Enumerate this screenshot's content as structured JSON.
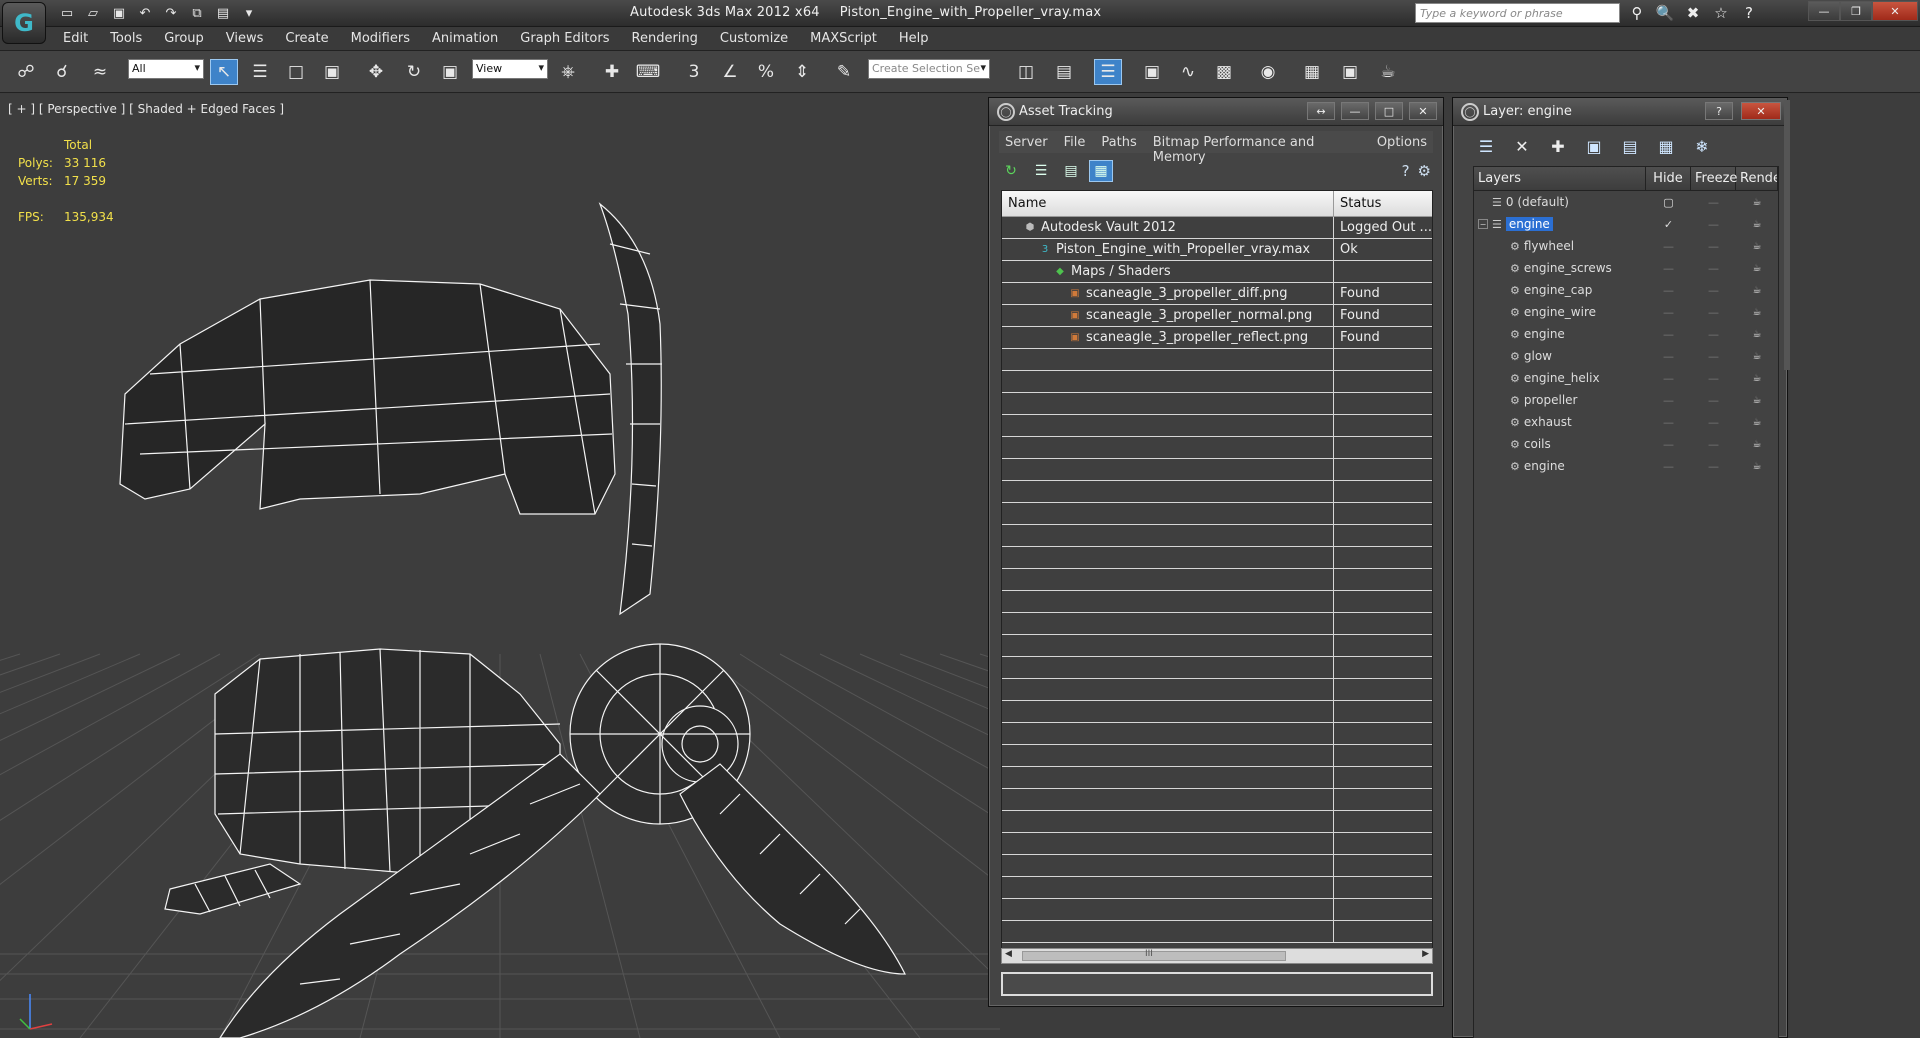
{
  "titlebar": {
    "logo_glyph": "G",
    "app_title": "Autodesk 3ds Max  2012 x64",
    "file_title": "Piston_Engine_with_Propeller_vray.max",
    "search_placeholder": "Type a keyword or phrase",
    "quick_access_icons": [
      "new-icon",
      "open-icon",
      "save-icon",
      "undo-icon",
      "redo-icon",
      "hold-icon",
      "project-icon",
      "customize-icon"
    ],
    "tool_icons": [
      "binoculars-icon",
      "key-search-icon",
      "communication-icon",
      "star-icon",
      "help-icon"
    ],
    "window_controls": [
      "minimize",
      "restore",
      "close"
    ]
  },
  "menu": [
    "Edit",
    "Tools",
    "Group",
    "Views",
    "Create",
    "Modifiers",
    "Animation",
    "Graph Editors",
    "Rendering",
    "Customize",
    "MAXScript",
    "Help"
  ],
  "toolbar": {
    "selection_filter": "All",
    "reference_coord": "View",
    "named_selection_placeholder": "Create Selection Se",
    "icons": [
      "link-icon",
      "unlink-icon",
      "bind-spacewarp-icon",
      "select-icon",
      "select-by-name-icon",
      "rect-region-icon",
      "window-crossing-icon",
      "move-icon",
      "rotate-icon",
      "scale-icon",
      "pivot-icon",
      "manipulate-icon",
      "keyboard-shortcut-icon",
      "snap-3-icon",
      "angle-snap-icon",
      "percent-snap-icon",
      "spinner-snap-icon",
      "edit-named-sel-icon",
      "mirror-icon",
      "align-icon",
      "layer-manager-icon",
      "ribbon-icon",
      "curve-editor-icon",
      "schematic-icon",
      "material-editor-icon",
      "render-setup-icon",
      "rendered-frame-icon",
      "render-icon"
    ]
  },
  "viewport": {
    "label": "[ + ] [ Perspective ] [ Shaded + Edged Faces ]",
    "stats_header": "Total",
    "polys_label": "Polys:",
    "polys_value": "33 116",
    "verts_label": "Verts:",
    "verts_value": "17 359",
    "fps_label": "FPS:",
    "fps_value": "135,934"
  },
  "asset_tracking": {
    "title": "Asset Tracking",
    "menu": [
      "Server",
      "File",
      "Paths",
      "Bitmap Performance and Memory",
      "Options"
    ],
    "col_name": "Name",
    "col_status": "Status",
    "rows": [
      {
        "name": "Autodesk Vault 2012",
        "status": "Logged Out ...",
        "indent": 1,
        "icon": "vault-icon"
      },
      {
        "name": "Piston_Engine_with_Propeller_vray.max",
        "status": "Ok",
        "indent": 2,
        "icon": "max-file-icon"
      },
      {
        "name": "Maps / Shaders",
        "status": "",
        "indent": 3,
        "icon": "maps-folder-icon"
      },
      {
        "name": "scaneagle_3_propeller_diff.png",
        "status": "Found",
        "indent": 4,
        "icon": "image-file-icon"
      },
      {
        "name": "scaneagle_3_propeller_normal.png",
        "status": "Found",
        "indent": 4,
        "icon": "image-file-icon"
      },
      {
        "name": "scaneagle_3_propeller_reflect.png",
        "status": "Found",
        "indent": 4,
        "icon": "image-file-icon"
      }
    ],
    "empty_rows": 27,
    "scroll_grip": "III"
  },
  "layer_dialog": {
    "title": "Layer: engine",
    "help_glyph": "?",
    "close_glyph": "✕",
    "col_layers": "Layers",
    "col_hide": "Hide",
    "col_freeze": "Freeze",
    "col_render": "Render",
    "layers": [
      {
        "name": "0 (default)",
        "level": 0,
        "selected": false,
        "active": false,
        "has_toggle": false,
        "is_layer": true
      },
      {
        "name": "engine",
        "level": 0,
        "selected": true,
        "active": true,
        "has_toggle": true,
        "is_layer": true
      },
      {
        "name": "flywheel",
        "level": 1,
        "selected": false,
        "active": false,
        "has_toggle": false,
        "is_layer": false
      },
      {
        "name": "engine_screws",
        "level": 1,
        "selected": false,
        "active": false,
        "has_toggle": false,
        "is_layer": false
      },
      {
        "name": "engine_cap",
        "level": 1,
        "selected": false,
        "active": false,
        "has_toggle": false,
        "is_layer": false
      },
      {
        "name": "engine_wire",
        "level": 1,
        "selected": false,
        "active": false,
        "has_toggle": false,
        "is_layer": false
      },
      {
        "name": "engine",
        "level": 1,
        "selected": false,
        "active": false,
        "has_toggle": false,
        "is_layer": false
      },
      {
        "name": "glow",
        "level": 1,
        "selected": false,
        "active": false,
        "has_toggle": false,
        "is_layer": false
      },
      {
        "name": "engine_helix",
        "level": 1,
        "selected": false,
        "active": false,
        "has_toggle": false,
        "is_layer": false
      },
      {
        "name": "propeller",
        "level": 1,
        "selected": false,
        "active": false,
        "has_toggle": false,
        "is_layer": false
      },
      {
        "name": "exhaust",
        "level": 1,
        "selected": false,
        "active": false,
        "has_toggle": false,
        "is_layer": false
      },
      {
        "name": "coils",
        "level": 1,
        "selected": false,
        "active": false,
        "has_toggle": false,
        "is_layer": false
      },
      {
        "name": "engine",
        "level": 1,
        "selected": false,
        "active": false,
        "has_toggle": false,
        "is_layer": false
      }
    ],
    "tools": [
      "create-layer-icon",
      "delete-layer-icon",
      "add-to-layer-icon",
      "select-highlighted-icon",
      "highlight-selected-icon",
      "hide-all-icon",
      "freeze-all-icon"
    ]
  },
  "colors": {
    "accent": "#3e83c9",
    "selection": "#2b6fd3",
    "stats": "#f2e04a",
    "wire": "#f4f4f4",
    "grid": "#5a5a5a"
  }
}
